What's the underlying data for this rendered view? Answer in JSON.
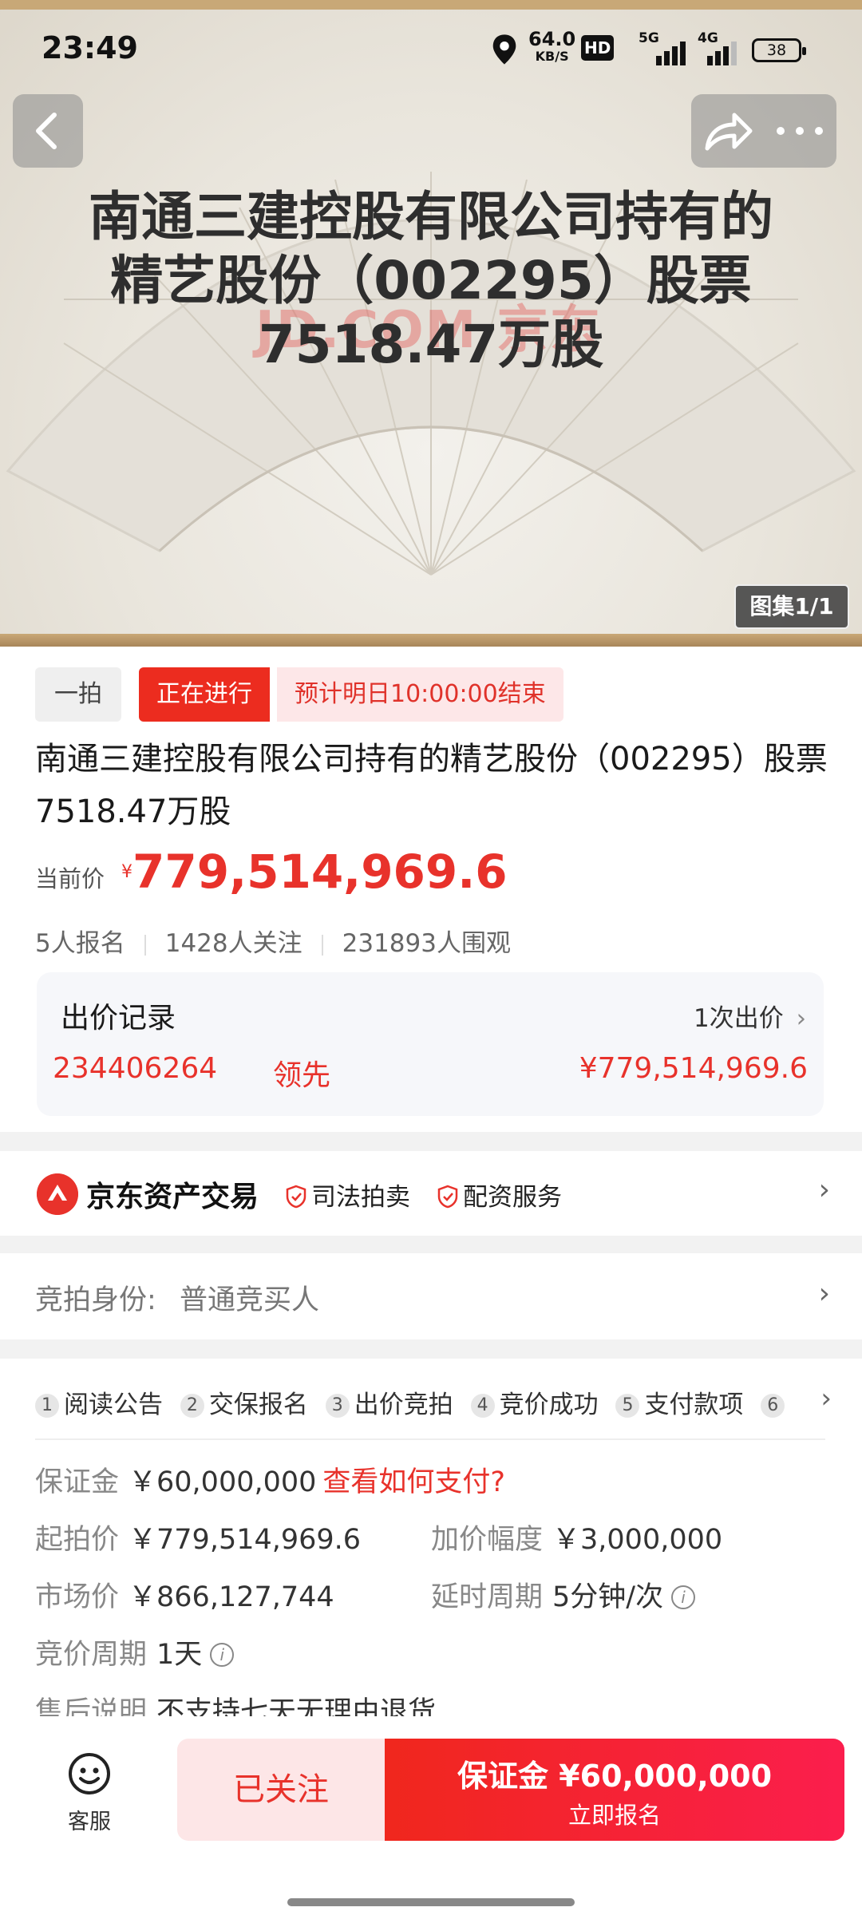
{
  "status_bar": {
    "time": "23:49",
    "net_speed": "64.0",
    "net_unit": "KB/S",
    "hd": "HD",
    "net1": "5G",
    "net2": "4G",
    "battery": "38"
  },
  "hero": {
    "title_line1": "南通三建控股有限公司持有的",
    "title_line2": "精艺股份（002295）股票",
    "title_line3": "7518.47万股",
    "watermark": "JD.COM 京东",
    "gallery_counter": "图集1/1"
  },
  "icons": {
    "back": "chevron-left-icon",
    "share": "share-icon",
    "more": "more-icon",
    "location": "location-icon",
    "signal": "signal-icon",
    "service": "smile-icon"
  },
  "auction": {
    "mode_tag": "一拍",
    "status_tag": "正在进行",
    "end_tag": "预计明日10:00:00结束",
    "title": "南通三建控股有限公司持有的精艺股份（002295）股票7518.47万股",
    "price_label": "当前价",
    "price_currency": "¥",
    "price": "779,514,969.6",
    "stat_signups": "5人报名",
    "stat_followers": "1428人关注",
    "stat_views": "231893人围观"
  },
  "bid_record": {
    "title": "出价记录",
    "count": "1次出价",
    "bidder": "234406264",
    "state": "领先",
    "amount": "¥779,514,969.6"
  },
  "seller": {
    "name": "京东资产交易",
    "badge1": "司法拍卖",
    "badge2": "配资服务"
  },
  "identity": {
    "label": "竞拍身份:",
    "value": "普通竞买人"
  },
  "steps": [
    {
      "num": "1",
      "label": "阅读公告"
    },
    {
      "num": "2",
      "label": "交保报名"
    },
    {
      "num": "3",
      "label": "出价竞拍"
    },
    {
      "num": "4",
      "label": "竞价成功"
    },
    {
      "num": "5",
      "label": "支付款项"
    },
    {
      "num": "6",
      "label": ""
    }
  ],
  "details": {
    "deposit_k": "保证金",
    "deposit_v": "￥60,000,000",
    "deposit_link": "查看如何支付?",
    "start_k": "起拍价",
    "start_v": "￥779,514,969.6",
    "increment_k": "加价幅度",
    "increment_v": "￥3,000,000",
    "market_k": "市场价",
    "market_v": "￥866,127,744",
    "delay_k": "延时周期",
    "delay_v": "5分钟/次",
    "cycle_k": "竞价周期",
    "cycle_v": "1天",
    "aftersale_k": "售后说明",
    "aftersale_v": "不支持七天无理由退货"
  },
  "bottom": {
    "service": "客服",
    "follow": "已关注",
    "signup_main": "保证金 ¥60,000,000",
    "signup_sub": "立即报名"
  },
  "colors": {
    "accent": "#e8322b",
    "tag_bg": "#ec2c1f",
    "tag_soft": "#fde7e8"
  }
}
